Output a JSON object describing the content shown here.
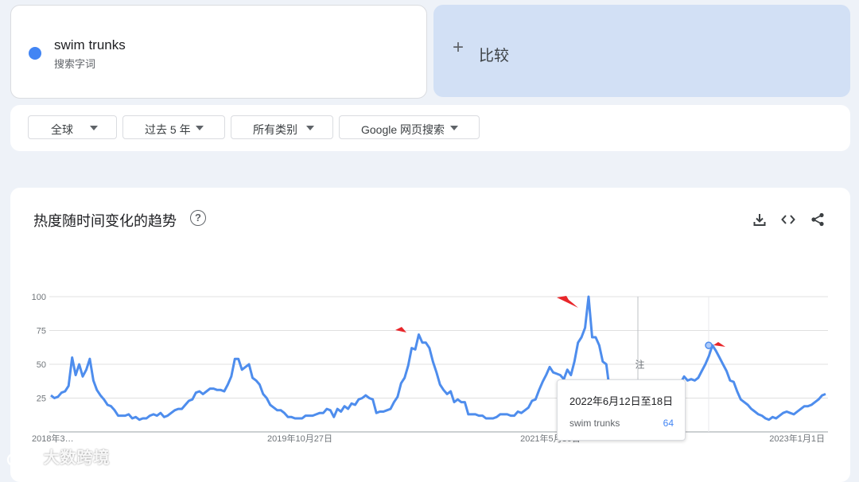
{
  "search_term": {
    "name": "swim trunks",
    "type_label": "搜索字词",
    "color": "#4285f4"
  },
  "compare": {
    "plus": "+",
    "label": "比较"
  },
  "filters": {
    "region": "全球",
    "time_range": "过去 5 年",
    "category": "所有类别",
    "search_type": "Google 网页搜索"
  },
  "chart_card": {
    "title": "热度随时间变化的趋势",
    "help_icon": "help-circle-icon",
    "tools": [
      "download-icon",
      "embed-code-icon",
      "share-icon"
    ]
  },
  "tooltip": {
    "date": "2022年6月12日至18日",
    "term": "swim trunks",
    "value": "64"
  },
  "annotation_label": "注",
  "watermark": "大数跨境",
  "chart_data": {
    "type": "line",
    "title": "",
    "xlabel": "",
    "ylabel": "",
    "ylim": [
      0,
      100
    ],
    "yticks": [
      "100",
      "75",
      "50",
      "25"
    ],
    "xtick_labels": [
      "2018年3…",
      "2019年10月27日",
      "2021年5月30日",
      "2023年1月1日"
    ],
    "series": [
      {
        "name": "swim trunks",
        "color": "#4e8ded",
        "values": [
          27,
          25,
          26,
          29,
          30,
          34,
          55,
          42,
          50,
          41,
          46,
          54,
          38,
          31,
          27,
          24,
          20,
          19,
          16,
          12,
          12,
          12,
          13,
          10,
          11,
          9,
          10,
          10,
          12,
          13,
          12,
          14,
          11,
          12,
          14,
          16,
          17,
          17,
          20,
          23,
          24,
          29,
          30,
          28,
          30,
          32,
          32,
          31,
          31,
          30,
          35,
          41,
          54,
          54,
          46,
          48,
          50,
          40,
          38,
          35,
          28,
          25,
          20,
          18,
          16,
          16,
          14,
          11,
          11,
          10,
          10,
          10,
          12,
          12,
          12,
          13,
          14,
          14,
          17,
          16,
          11,
          17,
          15,
          19,
          17,
          21,
          20,
          24,
          25,
          27,
          25,
          24,
          14,
          15,
          15,
          16,
          17,
          22,
          26,
          36,
          40,
          49,
          62,
          61,
          72,
          66,
          66,
          62,
          52,
          44,
          35,
          31,
          28,
          30,
          22,
          24,
          22,
          22,
          13,
          13,
          13,
          12,
          12,
          10,
          10,
          10,
          11,
          13,
          13,
          13,
          12,
          12,
          15,
          14,
          16,
          18,
          23,
          24,
          31,
          37,
          42,
          48,
          44,
          43,
          42,
          39,
          46,
          42,
          52,
          66,
          70,
          77,
          100,
          70,
          70,
          64,
          52,
          50,
          30,
          28,
          26,
          25,
          22,
          20,
          19,
          18,
          16,
          17,
          16,
          16,
          18,
          19,
          20,
          22,
          24,
          26,
          30,
          33,
          36,
          41,
          38,
          39,
          38,
          40,
          45,
          50,
          56,
          64,
          60,
          55,
          50,
          45,
          38,
          37,
          30,
          24,
          22,
          20,
          17,
          15,
          13,
          12,
          10,
          9,
          11,
          10,
          12,
          14,
          15,
          14,
          13,
          15,
          17,
          19,
          19,
          20,
          22,
          24,
          27,
          28
        ]
      }
    ],
    "grid": true,
    "legend": "none"
  }
}
